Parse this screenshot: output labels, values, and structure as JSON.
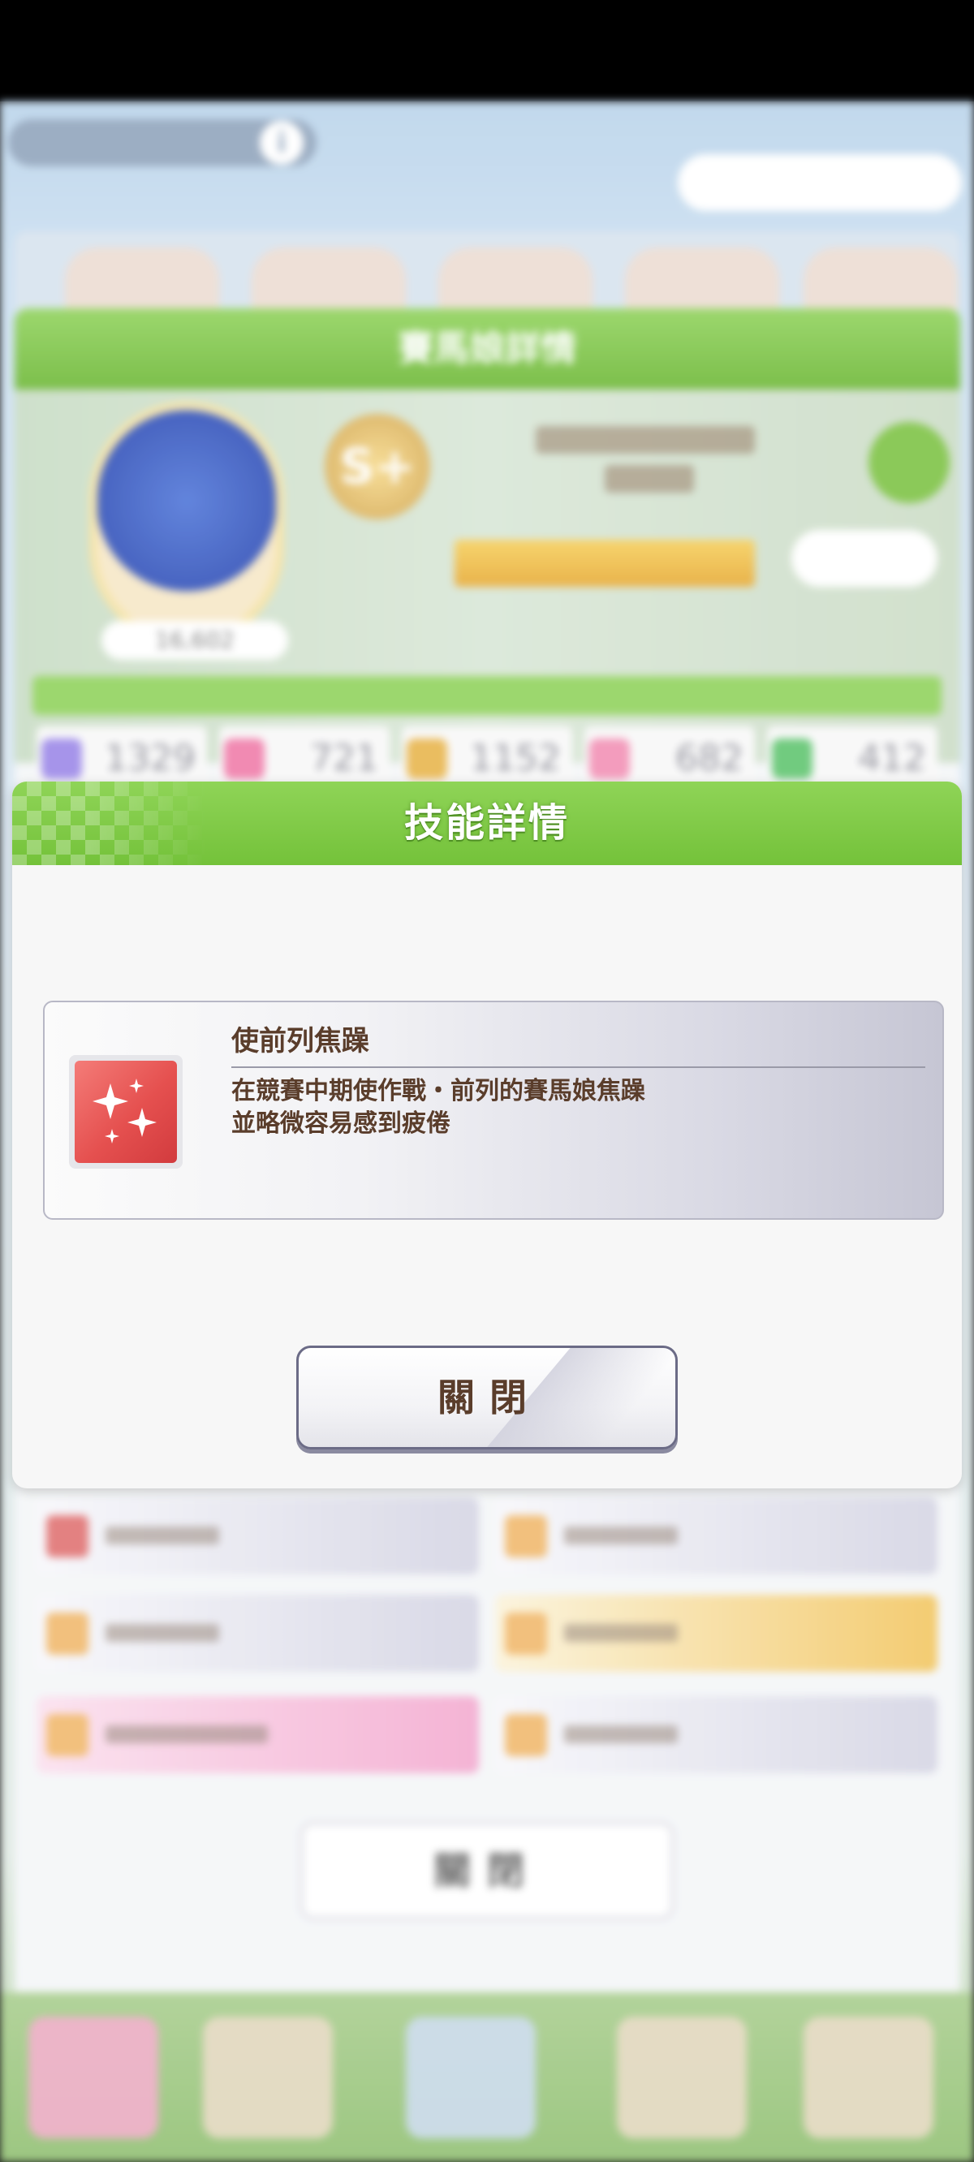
{
  "dialog": {
    "title": "技能詳情",
    "skill": {
      "icon": "sparkle-icon",
      "name": "使前列焦躁",
      "description_line1": "在競賽中期使作戰・前列的賽馬娘焦躁",
      "description_line2": "並略微容易感到疲倦"
    },
    "close_label": "關閉"
  },
  "background": {
    "panel_title": "賽馬娘詳情",
    "avatar_name": "16,602",
    "rank": "S+",
    "stats": [
      "1329",
      "721",
      "1152",
      "682",
      "412"
    ],
    "close_label": "關閉"
  },
  "colors": {
    "header_green": "#74c23a",
    "text_brown": "#5a3d2b",
    "skill_icon_red": "#e5504f"
  }
}
